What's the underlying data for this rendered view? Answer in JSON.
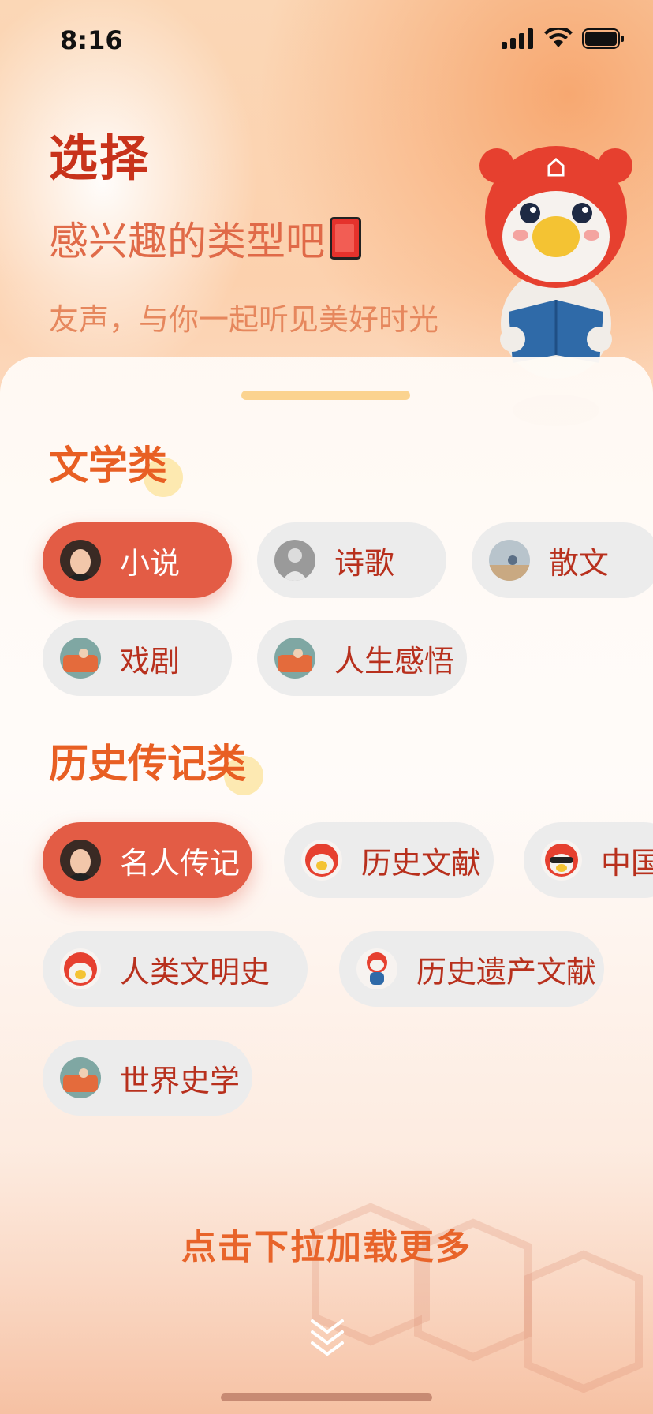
{
  "status_bar": {
    "time": "8:16"
  },
  "header": {
    "title": "选择",
    "subtitle": "感兴趣的类型吧",
    "subtitle_emoji": "📕",
    "slogan": "友声，与你一起听见美好时光"
  },
  "sections": [
    {
      "title": "文学类",
      "chips": [
        {
          "label": "小说",
          "selected": true,
          "avatar": "woman-portrait"
        },
        {
          "label": "诗歌",
          "selected": false,
          "avatar": "man-bw-portrait"
        },
        {
          "label": "散文",
          "selected": false,
          "avatar": "landscape-photo"
        },
        {
          "label": "戏剧",
          "selected": false,
          "avatar": "van-photo"
        },
        {
          "label": "人生感悟",
          "selected": false,
          "avatar": "van-photo"
        }
      ]
    },
    {
      "title": "历史传记类",
      "chips": [
        {
          "label": "名人传记",
          "selected": true,
          "avatar": "woman-portrait"
        },
        {
          "label": "历史文献",
          "selected": false,
          "avatar": "mascot-avatar"
        },
        {
          "label": "中国",
          "selected": false,
          "avatar": "mascot-sunglasses"
        },
        {
          "label": "人类文明史",
          "selected": false,
          "avatar": "mascot-avatar"
        },
        {
          "label": "历史遗产文献",
          "selected": false,
          "avatar": "mascot-standing"
        },
        {
          "label": "世界史学",
          "selected": false,
          "avatar": "van-photo"
        }
      ]
    }
  ],
  "footer": {
    "load_more": "点击下拉加载更多"
  },
  "colors": {
    "accent": "#e35c45",
    "title_red": "#c8321a",
    "section_orange": "#e85f23",
    "chip_text": "#b8301d",
    "chip_bg": "#ececec"
  }
}
